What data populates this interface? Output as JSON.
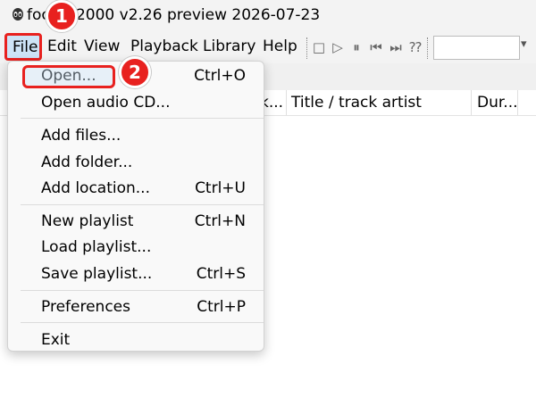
{
  "window": {
    "title": "foobar2000 v2.26 preview 2026-07-23"
  },
  "menubar": {
    "items": [
      {
        "label": "File"
      },
      {
        "label": "Edit"
      },
      {
        "label": "View"
      },
      {
        "label": "Playback"
      },
      {
        "label": "Library"
      },
      {
        "label": "Help"
      }
    ]
  },
  "toolbar": {
    "buttons": [
      {
        "icon": "stop-icon",
        "glyph": "□"
      },
      {
        "icon": "play-icon",
        "glyph": "▷"
      },
      {
        "icon": "pause-icon",
        "glyph": "⏸"
      },
      {
        "icon": "previous-icon",
        "glyph": "⏮"
      },
      {
        "icon": "next-icon",
        "glyph": "⏭"
      },
      {
        "icon": "random-icon",
        "glyph": "⁇"
      }
    ]
  },
  "columns": {
    "headers": [
      {
        "label": "k..."
      },
      {
        "label": "Title / track artist"
      },
      {
        "label": "Dur..."
      }
    ]
  },
  "file_menu": {
    "items": [
      {
        "label": "Open...",
        "shortcut": "Ctrl+O"
      },
      {
        "label": "Open audio CD...",
        "shortcut": ""
      },
      {
        "label": "Add files...",
        "shortcut": ""
      },
      {
        "label": "Add folder...",
        "shortcut": ""
      },
      {
        "label": "Add location...",
        "shortcut": "Ctrl+U"
      },
      {
        "label": "New playlist",
        "shortcut": "Ctrl+N"
      },
      {
        "label": "Load playlist...",
        "shortcut": ""
      },
      {
        "label": "Save playlist...",
        "shortcut": "Ctrl+S"
      },
      {
        "label": "Preferences",
        "shortcut": "Ctrl+P"
      },
      {
        "label": "Exit",
        "shortcut": ""
      }
    ]
  },
  "annotations": {
    "step1": "1",
    "step2": "2"
  },
  "colors": {
    "accent_red": "#e8211f",
    "highlight_blue": "#cde4f7"
  }
}
